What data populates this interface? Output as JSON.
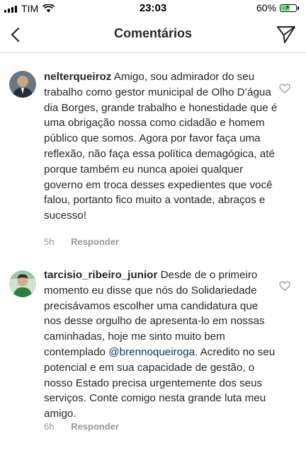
{
  "status_bar": {
    "carrier": "TIM",
    "time": "23:03",
    "battery_pct": "60%",
    "battery_level": 0.6,
    "battery_color": "#4cd964"
  },
  "nav": {
    "back_icon": "chevron-left-icon",
    "title": "Comentários",
    "send_icon": "paper-plane-icon"
  },
  "comments": [
    {
      "username": "nelterqueiroz",
      "text": "Amigo, sou admirador do seu trabalho como gestor municipal de Olho D’água dia Borges, grande trabalho e honestidade que é uma obrigação nossa como cidadão e homem público que somos. Agora por favor faça uma reflexão, não faça essa política demagógica, até porque também eu nunca apoiei qualquer governo em troca desses expedientes que você falou, portanto fico muito a vontade, abraços e sucesso!",
      "time": "5h",
      "reply_label": "Responder"
    },
    {
      "username": "tarcisio_ribeiro_junior",
      "text_before": "Desde de o primeiro momento eu disse que nós do Solidariedade precisávamos escolher uma candidatura que nos desse orgulho de apresenta-lo em nossas caminhadas, hoje me sinto muito bem contemplado",
      "mention": "@brennoqueiroga",
      "text_after": ". Acredito no seu potencial e em sua capacidade de gestão, o nosso Estado precisa urgentemente dos seus serviços. Conte comigo nesta grande luta meu amigo.",
      "time": "6h",
      "reply_label": "Responder"
    }
  ]
}
